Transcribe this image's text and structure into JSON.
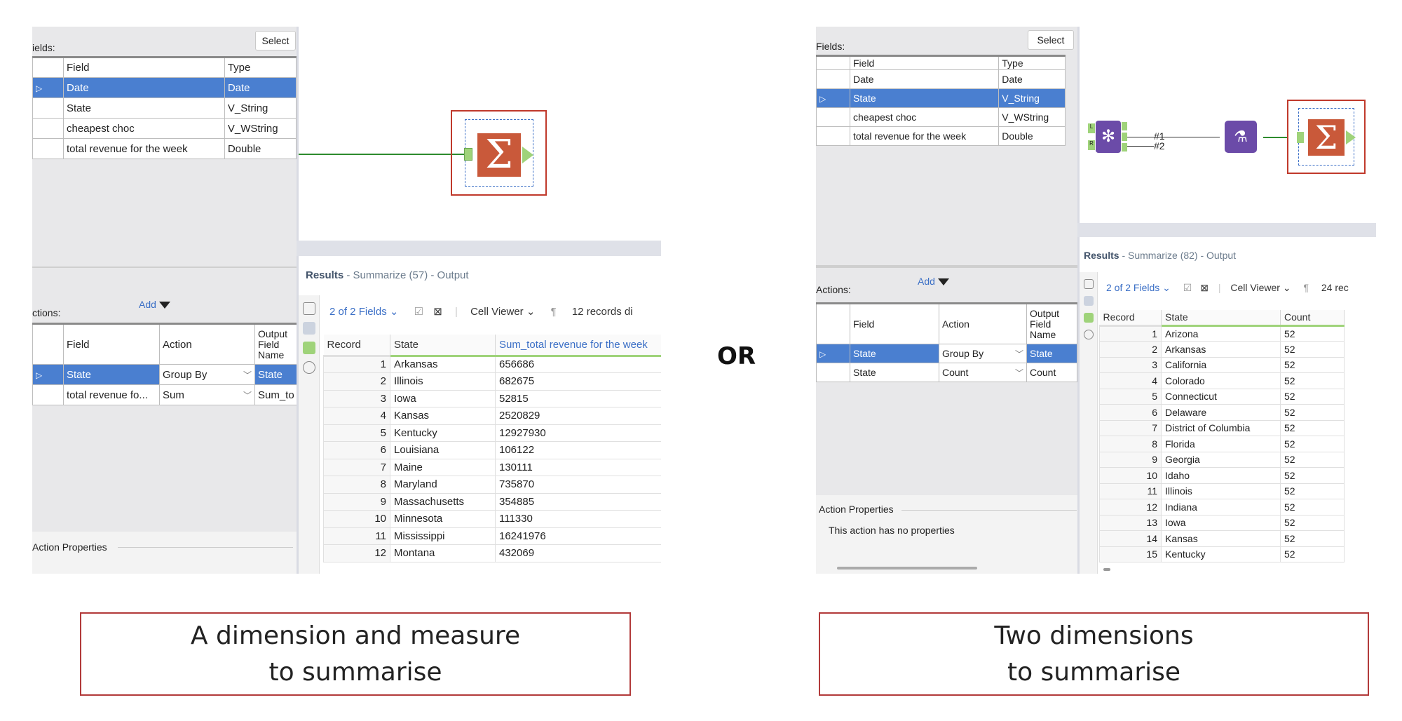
{
  "left": {
    "fields_label": "ields:",
    "select_label": "Select",
    "fields_headers": [
      "Field",
      "Type"
    ],
    "fields_rows": [
      {
        "field": "Date",
        "type": "Date"
      },
      {
        "field": "State",
        "type": "V_String"
      },
      {
        "field": "cheapest choc",
        "type": "V_WString"
      },
      {
        "field": "total revenue for the week",
        "type": "Double"
      }
    ],
    "actions_label": "ctions:",
    "add_label": "Add",
    "actions_headers": {
      "field": "Field",
      "action": "Action",
      "output": "Output Field Name"
    },
    "actions_rows": [
      {
        "field": "State",
        "action": "Group By",
        "output": "State"
      },
      {
        "field": "total revenue fo...",
        "action": "Sum",
        "output": "Sum_to"
      }
    ],
    "action_props_label": "Action Properties",
    "results_title": "Results",
    "results_sub": " - Summarize (57) - Output",
    "fields_count": "2 of 2 Fields",
    "cell_viewer": "Cell Viewer",
    "records_text": "12 records di",
    "result_headers": [
      "Record",
      "State",
      "Sum_total revenue for the week"
    ],
    "result_rows": [
      [
        "1",
        "Arkansas",
        "656686"
      ],
      [
        "2",
        "Illinois",
        "682675"
      ],
      [
        "3",
        "Iowa",
        "52815"
      ],
      [
        "4",
        "Kansas",
        "2520829"
      ],
      [
        "5",
        "Kentucky",
        "12927930"
      ],
      [
        "6",
        "Louisiana",
        "106122"
      ],
      [
        "7",
        "Maine",
        "130111"
      ],
      [
        "8",
        "Maryland",
        "735870"
      ],
      [
        "9",
        "Massachusetts",
        "354885"
      ],
      [
        "10",
        "Minnesota",
        "111330"
      ],
      [
        "11",
        "Mississippi",
        "16241976"
      ],
      [
        "12",
        "Montana",
        "432069"
      ]
    ]
  },
  "or_label": "OR",
  "right": {
    "fields_label": "Fields:",
    "select_label": "Select",
    "fields_headers": [
      "Field",
      "Type"
    ],
    "fields_rows": [
      {
        "field": "Date",
        "type": "Date"
      },
      {
        "field": "State",
        "type": "V_String"
      },
      {
        "field": "cheapest choc",
        "type": "V_WString"
      },
      {
        "field": "total revenue for the week",
        "type": "Double"
      }
    ],
    "actions_label": "Actions:",
    "add_label": "Add",
    "actions_headers": {
      "field": "Field",
      "action": "Action",
      "output": "Output Field Name"
    },
    "actions_rows": [
      {
        "field": "State",
        "action": "Group By",
        "output": "State"
      },
      {
        "field": "State",
        "action": "Count",
        "output": "Count"
      }
    ],
    "action_props_label": "Action Properties",
    "no_props": "This action has no properties",
    "results_title": "Results",
    "results_sub": " - Summarize (82) - Output",
    "fields_count": "2 of 2 Fields",
    "cell_viewer": "Cell Viewer",
    "records_text": "24 rec",
    "join_labels": [
      "#1",
      "#2"
    ],
    "result_headers": [
      "Record",
      "State",
      "Count"
    ],
    "result_rows": [
      [
        "1",
        "Arizona",
        "52"
      ],
      [
        "2",
        "Arkansas",
        "52"
      ],
      [
        "3",
        "California",
        "52"
      ],
      [
        "4",
        "Colorado",
        "52"
      ],
      [
        "5",
        "Connecticut",
        "52"
      ],
      [
        "6",
        "Delaware",
        "52"
      ],
      [
        "7",
        "District of Columbia",
        "52"
      ],
      [
        "8",
        "Florida",
        "52"
      ],
      [
        "9",
        "Georgia",
        "52"
      ],
      [
        "10",
        "Idaho",
        "52"
      ],
      [
        "11",
        "Illinois",
        "52"
      ],
      [
        "12",
        "Indiana",
        "52"
      ],
      [
        "13",
        "Iowa",
        "52"
      ],
      [
        "14",
        "Kansas",
        "52"
      ],
      [
        "15",
        "Kentucky",
        "52"
      ]
    ]
  },
  "captions": {
    "left": [
      "A dimension and measure",
      "to summarise"
    ],
    "right": [
      "Two dimensions",
      "to summarise"
    ]
  },
  "colors": {
    "selected_row": "#4a7fd0",
    "summarize_tool": "#c9593a",
    "tool_border": "#c0392b",
    "purple_tool": "#6b4ba8",
    "connector_green": "#2e8b2e",
    "caption_border": "#b23a3a"
  }
}
